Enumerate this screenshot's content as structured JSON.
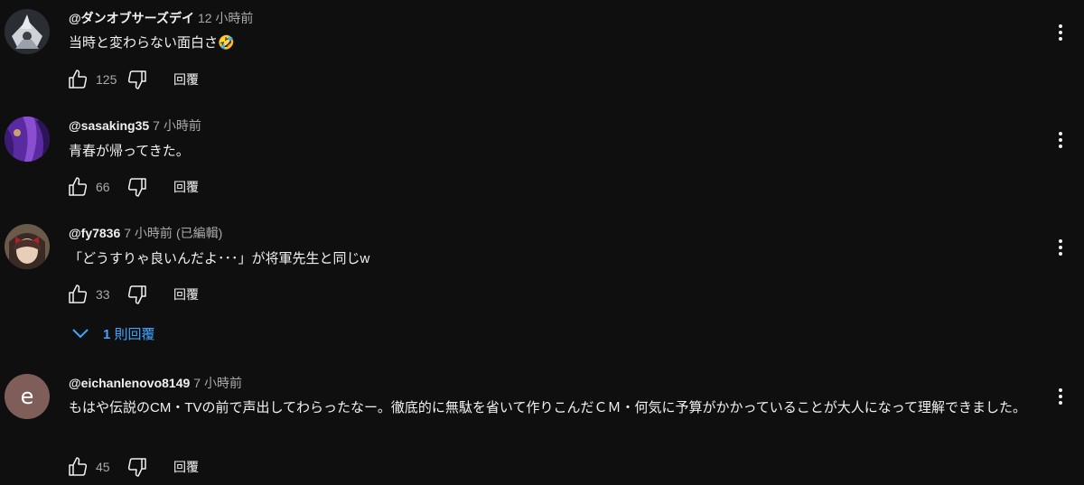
{
  "comments": [
    {
      "author": "@ダンオブサーズデイ",
      "time": "12 小時前",
      "edited": "",
      "text": "当時と変わらない面白さ🤣",
      "likes": "125",
      "reply_label": "回覆",
      "avatar": "character-icon"
    },
    {
      "author": "@sasaking35",
      "time": "7 小時前",
      "edited": "",
      "text": "青春が帰ってきた。",
      "likes": "66",
      "reply_label": "回覆",
      "avatar": "purple-art-icon"
    },
    {
      "author": "@fy7836",
      "time": "7 小時前",
      "edited": "(已編輯)",
      "text": "「どうすりゃ良いんだよ･･･」が将軍先生と同じw",
      "likes": "33",
      "reply_label": "回覆",
      "avatar": "anime-girl-icon",
      "replies_toggle": {
        "count": "1",
        "label": "則回覆"
      }
    },
    {
      "author": "@eichanlenovo8149",
      "time": "7 小時前",
      "edited": "",
      "text": "もはや伝説のCM・TVの前で声出してわらったなー。徹底的に無駄を省いて作りこんだＣＭ・何気に予算がかかっていることが大人になって理解できました。",
      "likes": "45",
      "reply_label": "回覆",
      "avatar_letter": "e",
      "avatar_color": "#7f5e5a"
    }
  ]
}
